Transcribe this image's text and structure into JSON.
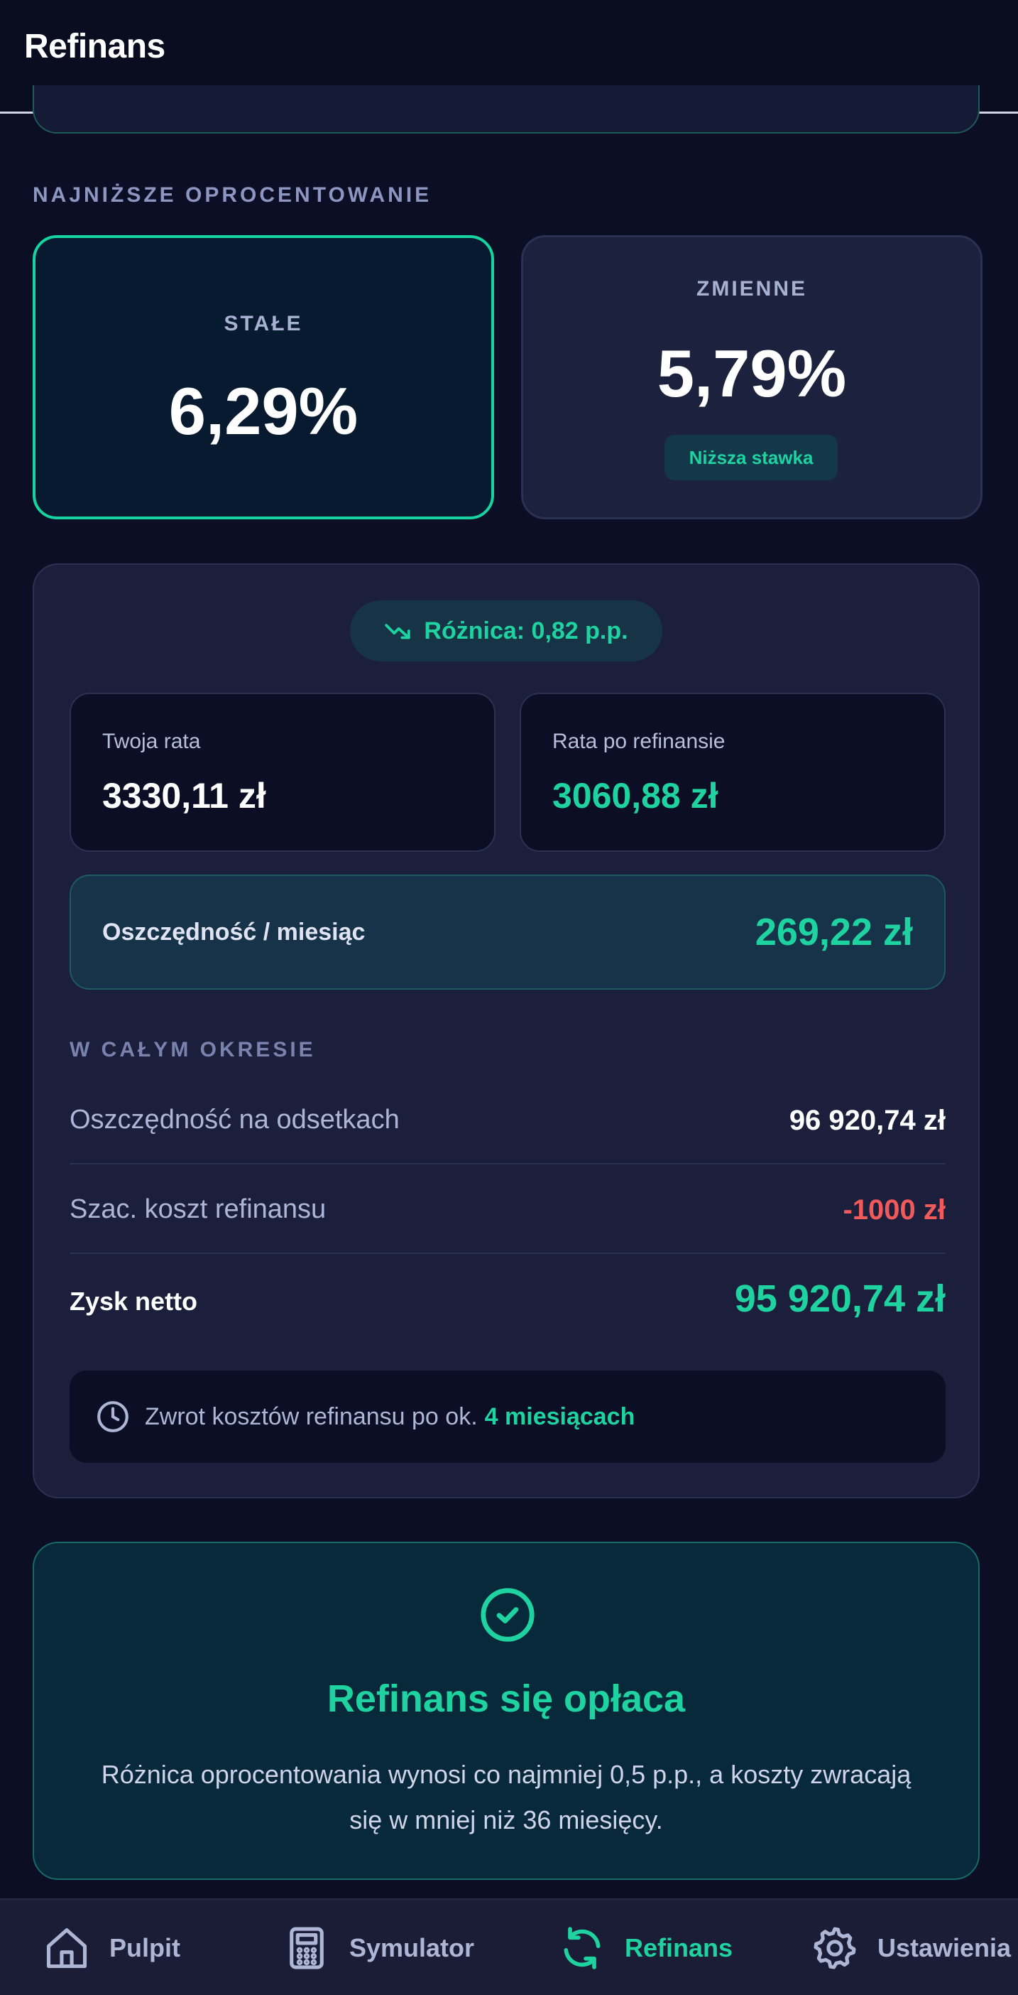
{
  "header": {
    "title": "Refinans"
  },
  "rates": {
    "section_label": "NAJNIŻSZE OPROCENTOWANIE",
    "fixed": {
      "label": "STAŁE",
      "value": "6,29%"
    },
    "variable": {
      "label": "ZMIENNE",
      "value": "5,79%",
      "badge": "Niższa stawka"
    }
  },
  "comparison": {
    "difference": "Różnica: 0,82 p.p.",
    "current_rate_label": "Twoja rata",
    "current_rate_value": "3330,11 zł",
    "new_rate_label": "Rata po refinansie",
    "new_rate_value": "3060,88 zł",
    "monthly_savings_label": "Oszczędność / miesiąc",
    "monthly_savings_value": "269,22 zł",
    "period_label": "W CAŁYM OKRESIE",
    "rows": [
      {
        "label": "Oszczędność na odsetkach",
        "value": "96 920,74 zł"
      },
      {
        "label": "Szac. koszt refinansu",
        "value": "-1000 zł"
      },
      {
        "label": "Zysk netto",
        "value": "95 920,74 zł"
      }
    ],
    "payback_text": "Zwrot kosztów refinansu po ok.",
    "payback_value": "4 miesiącach"
  },
  "verdict": {
    "title": "Refinans się opłaca",
    "description": "Różnica oprocentowania wynosi co najmniej 0,5 p.p., a koszty zwracają się w mniej niż 36 miesięcy."
  },
  "nav": {
    "items": [
      {
        "label": "Pulpit",
        "icon": "home-icon"
      },
      {
        "label": "Symulator",
        "icon": "calculator-icon"
      },
      {
        "label": "Refinans",
        "icon": "refresh-icon",
        "active": true
      },
      {
        "label": "Ustawienia",
        "icon": "gear-icon"
      }
    ]
  },
  "colors": {
    "background": "#0b0e24",
    "accent": "#1ed3a0",
    "negative": "#f15a5a",
    "card": "#1b1f3b"
  }
}
